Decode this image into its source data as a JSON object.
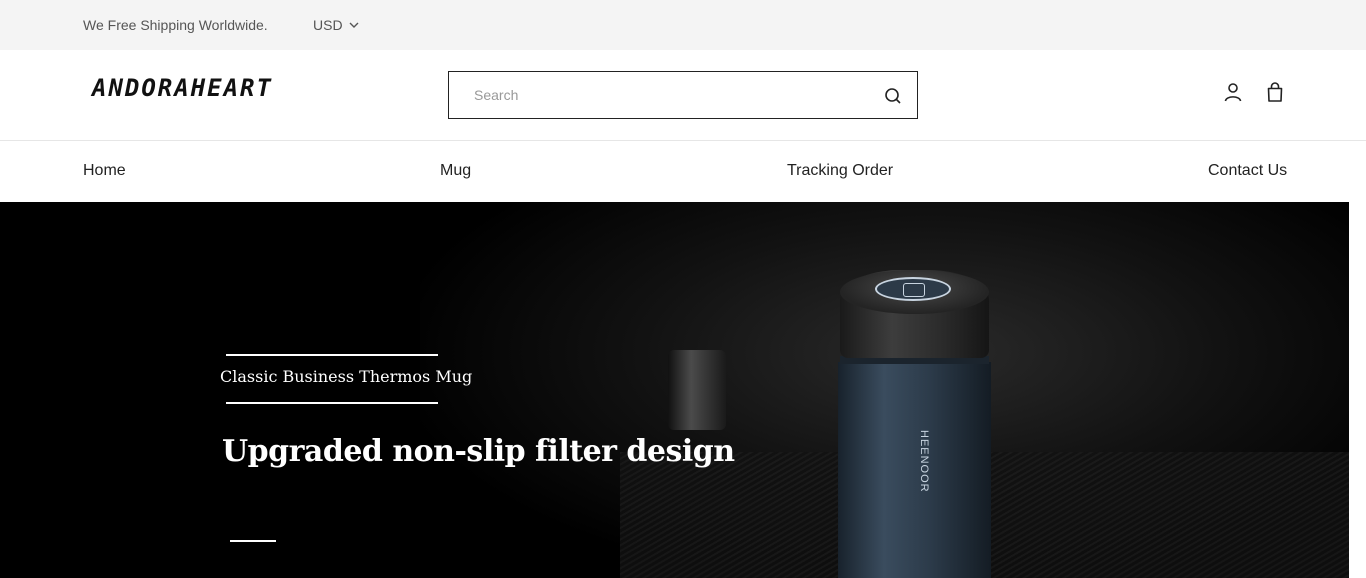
{
  "topbar": {
    "shipping_text": "We Free Shipping Worldwide.",
    "currency": "USD"
  },
  "header": {
    "logo_text": "ANDORAHEART",
    "search_placeholder": "Search"
  },
  "nav": {
    "items": [
      {
        "label": "Home"
      },
      {
        "label": "Mug"
      },
      {
        "label": "Tracking Order"
      },
      {
        "label": "Contact Us"
      }
    ]
  },
  "hero": {
    "kicker": "Classic Business Thermos Mug",
    "headline": "Upgraded non-slip filter design",
    "product_brand": "HEENOOR"
  },
  "icons": {
    "search": "search-icon",
    "account": "user-icon",
    "cart": "shopping-bag-icon",
    "currency_dropdown": "chevron-down-icon"
  },
  "colors": {
    "topbar_bg": "#f4f4f4",
    "hero_bg": "#000000",
    "text_dark": "#222222"
  }
}
